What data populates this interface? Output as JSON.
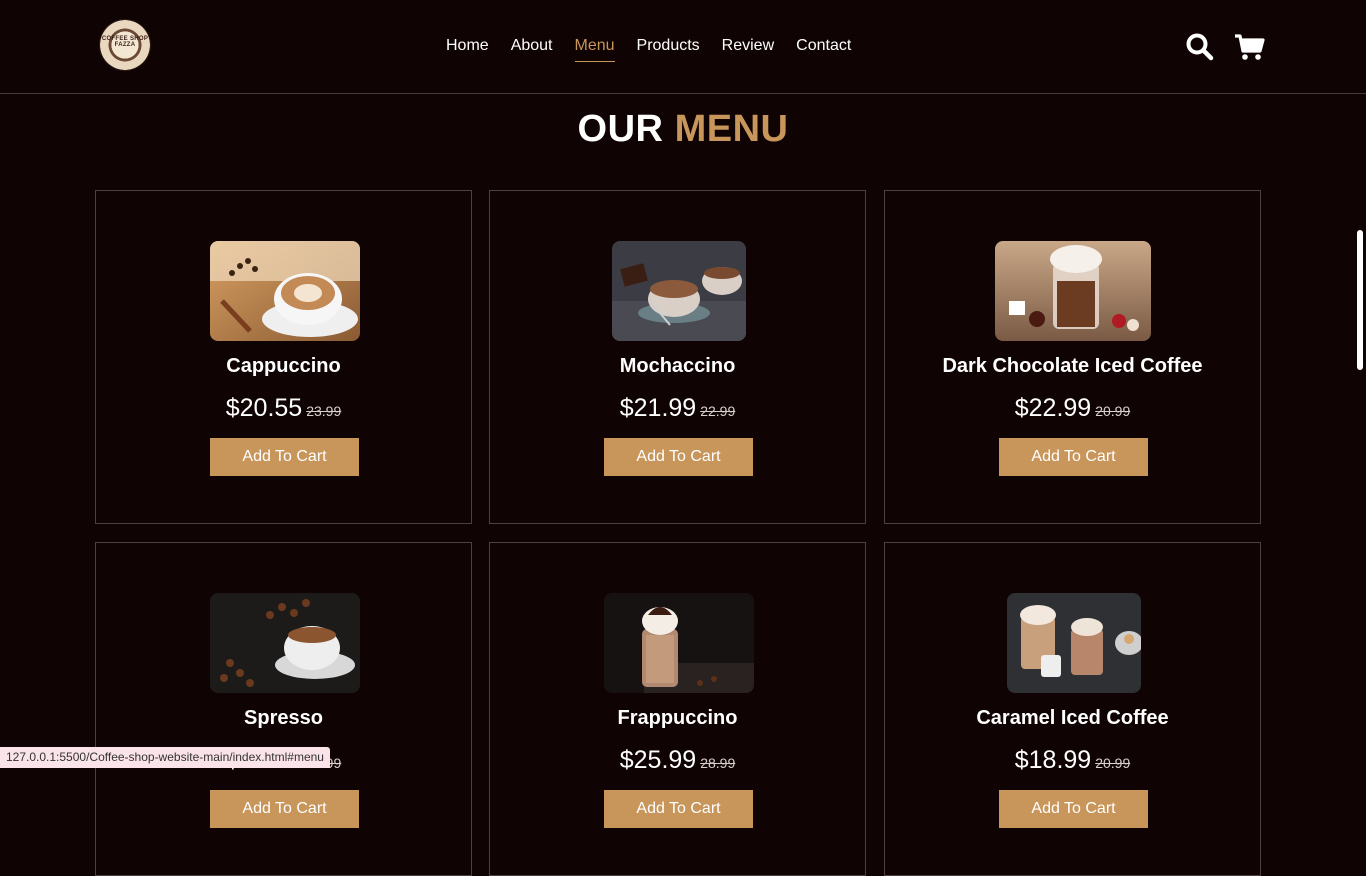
{
  "header": {
    "logo_alt": "Coffee Shop Fazza",
    "logo_text": "COFFEE SHOP FAZZA",
    "nav": [
      {
        "label": "Home",
        "active": false
      },
      {
        "label": "About",
        "active": false
      },
      {
        "label": "Menu",
        "active": true
      },
      {
        "label": "Products",
        "active": false
      },
      {
        "label": "Review",
        "active": false
      },
      {
        "label": "Contact",
        "active": false
      }
    ],
    "search_icon": "search-icon",
    "cart_icon": "cart-icon"
  },
  "section": {
    "title_main": "OUR",
    "title_accent": "MENU"
  },
  "menu_items": [
    {
      "name": "Cappuccino",
      "price": "$20.55",
      "old_price": "23.99",
      "button": "Add To Cart"
    },
    {
      "name": "Mochaccino",
      "price": "$21.99",
      "old_price": "22.99",
      "button": "Add To Cart"
    },
    {
      "name": "Dark Chocolate Iced Coffee",
      "price": "$22.99",
      "old_price": "20.99",
      "button": "Add To Cart"
    },
    {
      "name": "Spresso",
      "price": "$22.99",
      "old_price": "23.99",
      "button": "Add To Cart"
    },
    {
      "name": "Frappuccino",
      "price": "$25.99",
      "old_price": "28.99",
      "button": "Add To Cart"
    },
    {
      "name": "Caramel Iced Coffee",
      "price": "$18.99",
      "old_price": "20.99",
      "button": "Add To Cart"
    }
  ],
  "status_bar": {
    "url": "127.0.0.1:5500/Coffee-shop-website-main/index.html#menu"
  },
  "colors": {
    "background": "#0f0303",
    "accent": "#c8955a",
    "border": "#4f403b"
  }
}
